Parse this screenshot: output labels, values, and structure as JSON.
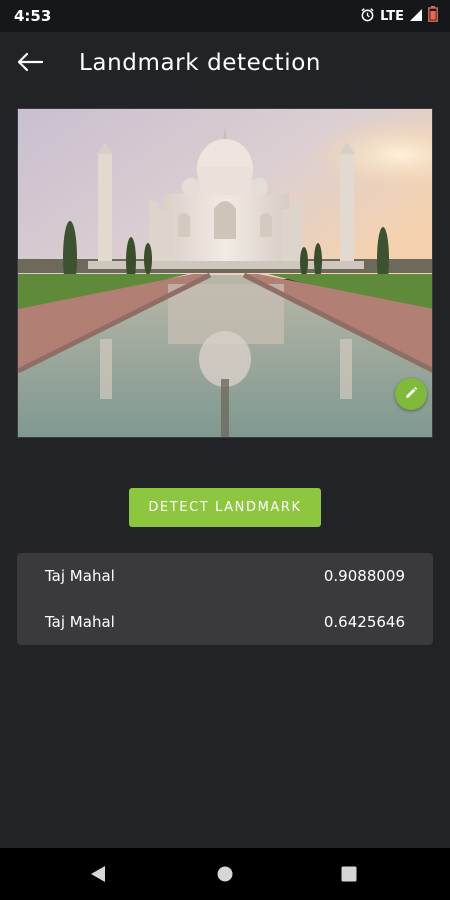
{
  "status_bar": {
    "time": "4:53",
    "network": "LTE",
    "icons": [
      "alarm-icon",
      "signal-icon",
      "battery-icon"
    ]
  },
  "toolbar": {
    "title": "Landmark detection",
    "back_icon": "arrow-left-icon"
  },
  "image": {
    "subject": "Taj Mahal photo",
    "edit_icon": "pencil-icon"
  },
  "detect_button": {
    "label": "DETECT LANDMARK"
  },
  "results": [
    {
      "name": "Taj Mahal",
      "confidence": "0.9088009"
    },
    {
      "name": "Taj Mahal",
      "confidence": "0.6425646"
    }
  ],
  "nav_bar": {
    "icons": [
      "nav-back-icon",
      "nav-home-icon",
      "nav-recents-icon"
    ]
  },
  "colors": {
    "background": "#222326",
    "accent": "#8dc63f",
    "card": "#3a3a3d"
  }
}
